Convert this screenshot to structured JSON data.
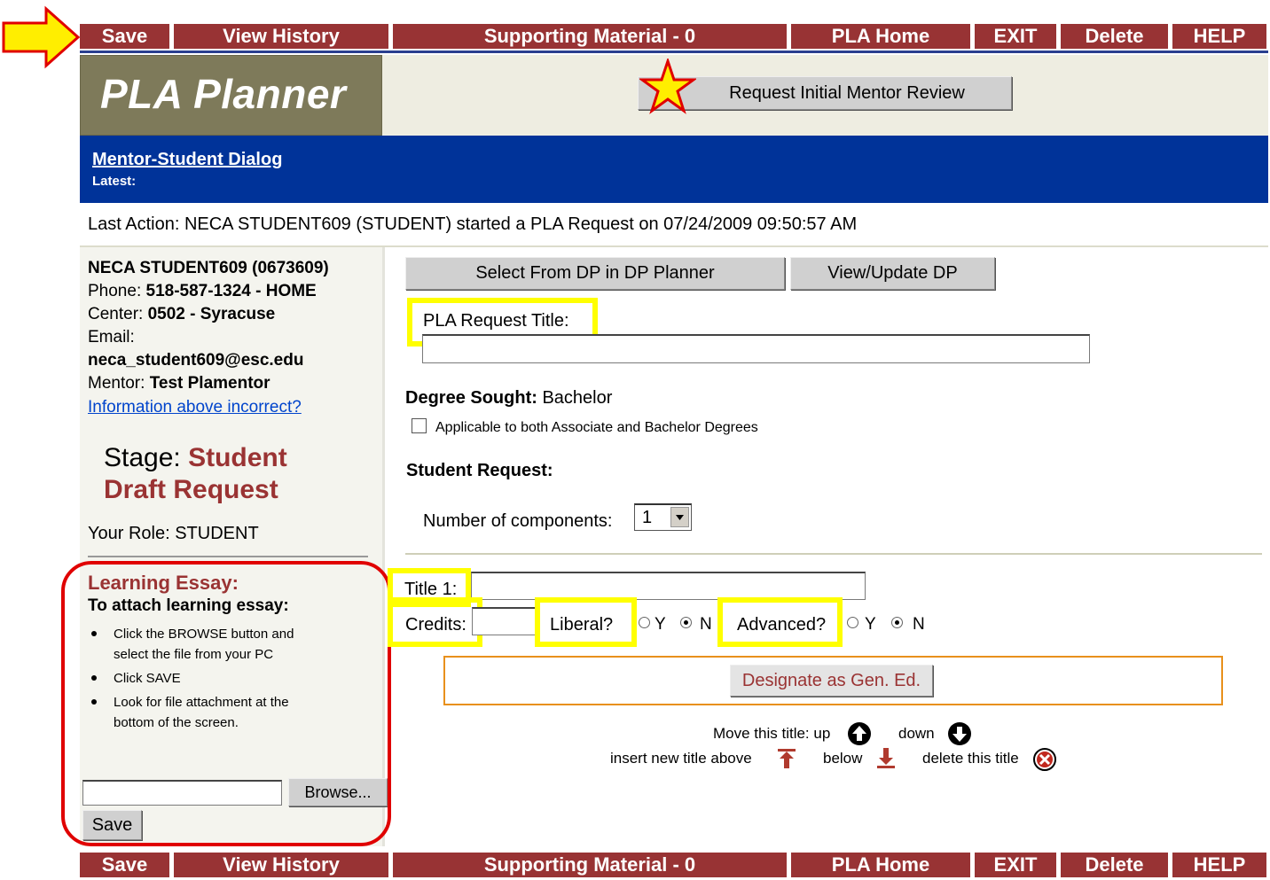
{
  "nav": {
    "items": [
      "Save",
      "View History",
      "Supporting Material - 0",
      "PLA Home",
      "EXIT",
      "Delete",
      "HELP"
    ]
  },
  "header": {
    "logo_text": "PLA Planner",
    "request_review_label": "Request Initial Mentor Review"
  },
  "dialog": {
    "link_label": "Mentor-Student Dialog",
    "latest_label": "Latest:"
  },
  "last_action": "Last Action: NECA STUDENT609 (STUDENT) started a PLA Request on 07/24/2009 09:50:57 AM",
  "student": {
    "name_line": "NECA STUDENT609 (0673609)",
    "phone_label": "Phone:",
    "phone_value": "518-587-1324 - HOME",
    "center_label": "Center:",
    "center_value": "0502 - Syracuse",
    "email_label": "Email:",
    "email_value": "neca_student609@esc.edu",
    "mentor_label": "Mentor:",
    "mentor_value": "Test Plamentor",
    "info_link": "Information above incorrect?",
    "stage_label": "Stage:",
    "stage_value_1": "Student",
    "stage_value_2": "Draft Request",
    "role_text": "Your Role: STUDENT"
  },
  "essay": {
    "heading": "Learning Essay:",
    "subheading": "To attach learning essay:",
    "steps": [
      [
        "Click the BROWSE button and",
        "select the file from your PC"
      ],
      [
        "Click SAVE"
      ],
      [
        "Look for file attachment at the",
        "bottom of the screen."
      ]
    ],
    "browse_label": "Browse...",
    "save_label": "Save"
  },
  "main": {
    "select_dp_label": "Select From DP in DP Planner",
    "view_dp_label": "View/Update DP",
    "request_title_label": "PLA Request Title:",
    "request_title_value": "",
    "degree_label": "Degree Sought:",
    "degree_value": "Bachelor",
    "applicable_label": "Applicable to both Associate and Bachelor Degrees",
    "student_request_label": "Student Request:",
    "components_label": "Number of components:",
    "components_value": "1",
    "title1_label": "Title 1:",
    "credits_label": "Credits:",
    "liberal_label": "Liberal?",
    "advanced_label": "Advanced?",
    "y_label": "Y",
    "n_label": "N",
    "gen_ed_label": "Designate as Gen. Ed.",
    "move_title_label": "Move this title: up",
    "down_label": "down",
    "insert_above_label": "insert new title above",
    "below_label": "below",
    "delete_label": "delete this title"
  },
  "colors": {
    "nav_bg": "#983334",
    "dialog_bar": "#003399",
    "logo_bg": "#7e7a5a",
    "highlight_yellow": "#ffff00",
    "annotation_red": "#e00000",
    "gen_ed_border": "#e8901c"
  }
}
